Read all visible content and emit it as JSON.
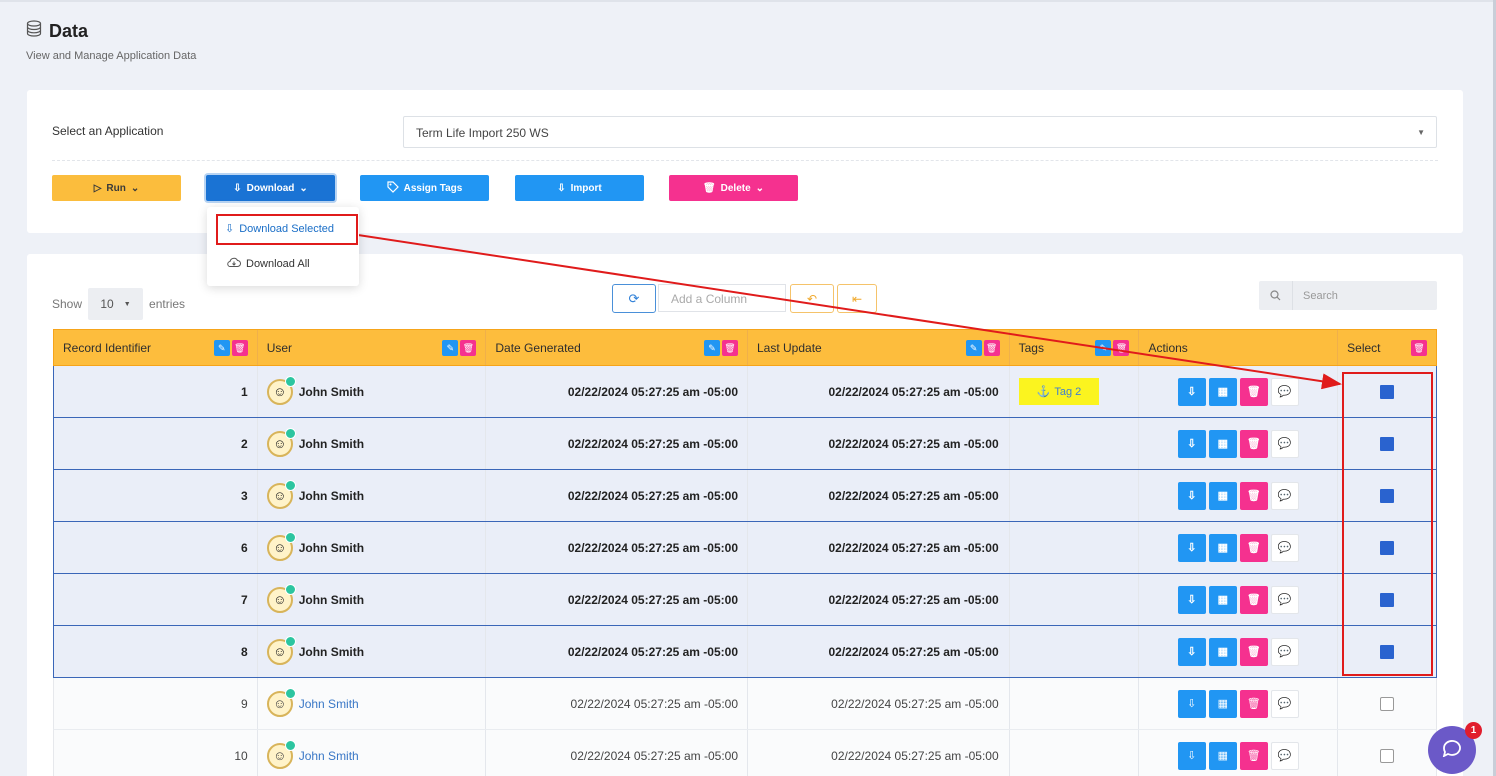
{
  "page": {
    "title": "Data",
    "subtitle": "View and Manage Application Data"
  },
  "app_select": {
    "label": "Select an Application",
    "value": "Term Life Import 250 WS"
  },
  "toolbar": {
    "run_label": "Run",
    "download_label": "Download",
    "assign_tags_label": "Assign Tags",
    "import_label": "Import",
    "delete_label": "Delete"
  },
  "download_menu": {
    "selected_label": "Download Selected",
    "all_label": "Download All"
  },
  "table_controls": {
    "show_label": "Show",
    "entries_value": "10",
    "entries_label": "entries",
    "add_column_placeholder": "Add a Column",
    "search_placeholder": "Search"
  },
  "columns": {
    "record_identifier": "Record Identifier",
    "user": "User",
    "date_generated": "Date Generated",
    "last_update": "Last Update",
    "tags": "Tags",
    "actions": "Actions",
    "select": "Select"
  },
  "rows": [
    {
      "id": "1",
      "user": "John Smith",
      "date_generated": "02/22/2024 05:27:25 am -05:00",
      "last_update": "02/22/2024 05:27:25 am -05:00",
      "tag": "Tag 2",
      "selected": true
    },
    {
      "id": "2",
      "user": "John Smith",
      "date_generated": "02/22/2024 05:27:25 am -05:00",
      "last_update": "02/22/2024 05:27:25 am -05:00",
      "tag": "",
      "selected": true
    },
    {
      "id": "3",
      "user": "John Smith",
      "date_generated": "02/22/2024 05:27:25 am -05:00",
      "last_update": "02/22/2024 05:27:25 am -05:00",
      "tag": "",
      "selected": true
    },
    {
      "id": "6",
      "user": "John Smith",
      "date_generated": "02/22/2024 05:27:25 am -05:00",
      "last_update": "02/22/2024 05:27:25 am -05:00",
      "tag": "",
      "selected": true
    },
    {
      "id": "7",
      "user": "John Smith",
      "date_generated": "02/22/2024 05:27:25 am -05:00",
      "last_update": "02/22/2024 05:27:25 am -05:00",
      "tag": "",
      "selected": true
    },
    {
      "id": "8",
      "user": "John Smith",
      "date_generated": "02/22/2024 05:27:25 am -05:00",
      "last_update": "02/22/2024 05:27:25 am -05:00",
      "tag": "",
      "selected": true
    },
    {
      "id": "9",
      "user": "John Smith",
      "date_generated": "02/22/2024 05:27:25 am -05:00",
      "last_update": "02/22/2024 05:27:25 am -05:00",
      "tag": "",
      "selected": false
    },
    {
      "id": "10",
      "user": "John Smith",
      "date_generated": "02/22/2024 05:27:25 am -05:00",
      "last_update": "02/22/2024 05:27:25 am -05:00",
      "tag": "",
      "selected": false
    }
  ],
  "chat": {
    "badge_count": "1"
  },
  "colors": {
    "accent_blue": "#2196f3",
    "header_yellow": "#fdbd3d",
    "delete_pink": "#f5318f",
    "annotation_red": "#e01b1b"
  }
}
